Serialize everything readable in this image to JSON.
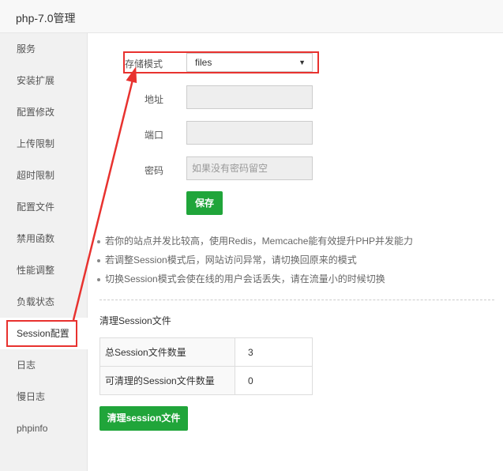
{
  "window": {
    "title": "php-7.0管理"
  },
  "sidebar": {
    "items": [
      {
        "label": "服务"
      },
      {
        "label": "安装扩展"
      },
      {
        "label": "配置修改"
      },
      {
        "label": "上传限制"
      },
      {
        "label": "超时限制"
      },
      {
        "label": "配置文件"
      },
      {
        "label": "禁用函数"
      },
      {
        "label": "性能调整"
      },
      {
        "label": "负载状态"
      },
      {
        "label": "Session配置"
      },
      {
        "label": "日志"
      },
      {
        "label": "慢日志"
      },
      {
        "label": "phpinfo"
      }
    ],
    "active_index": 9
  },
  "form": {
    "mode_label": "存储模式",
    "mode_value": "files",
    "address_label": "地址",
    "address_value": "",
    "port_label": "端口",
    "port_value": "",
    "password_label": "密码",
    "password_placeholder": "如果没有密码留空",
    "save_label": "保存"
  },
  "tips": [
    "若你的站点并发比较高，使用Redis，Memcache能有效提升PHP并发能力",
    "若调整Session模式后，网站访问异常，请切换回原来的模式",
    "切换Session模式会使在线的用户会话丢失，请在流量小的时候切换"
  ],
  "clean_section": {
    "title": "清理Session文件",
    "rows": [
      {
        "key": "总Session文件数量",
        "value": "3"
      },
      {
        "key": "可清理的Session文件数量",
        "value": "0"
      }
    ],
    "button_label": "清理session文件"
  },
  "colors": {
    "accent": "#20a53a",
    "annotation": "#e8322f"
  },
  "icons": {
    "dropdown": "caret-down-icon"
  }
}
